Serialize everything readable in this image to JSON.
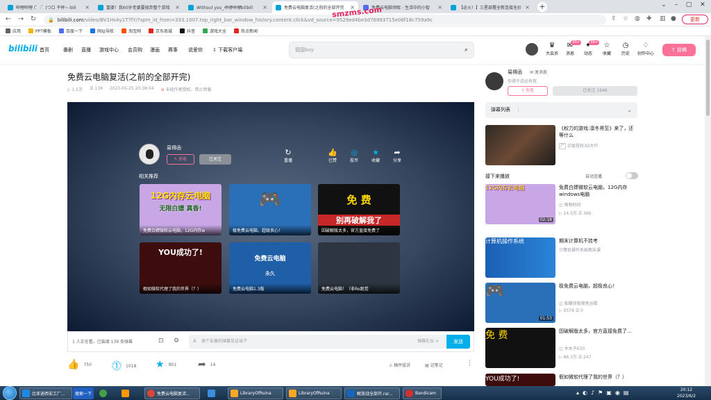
{
  "browser": {
    "tabs": [
      {
        "label": "哔哩哔哩 (゜-゜)つロ 干杯~-bili",
        "color": "#00a1d6"
      },
      {
        "label": "富婆！我60岁老婆要抛弃整个游戏",
        "color": "#00a1d6"
      },
      {
        "label": "Without you_哔哩哔哩bilibili",
        "color": "#00a1d6"
      },
      {
        "label": "免费云电脑复活(之前的全部开完",
        "color": "#00a1d6"
      },
      {
        "label": "免费云电脑领取 - 生活中的小智",
        "color": "#4e6ef2"
      },
      {
        "label": "【必火！】三星部署全新连接无价",
        "color": "#00a1d6"
      }
    ],
    "new_tab": "+",
    "url_host": "bilibili.com",
    "url_path": "/video/BV1Hs4y1T7fY/?spm_id_from=333.1007.top_right_bar_window_history.content.click&vd_source=9529ed4be3d76993715e06f18c759a9c",
    "watermark": "smzms.com",
    "update_label": "更新",
    "bookmarks": [
      {
        "label": "应用",
        "color": "#5f6368"
      },
      {
        "label": "PPT模板",
        "color": "#f4b400"
      },
      {
        "label": "百度一下",
        "color": "#4e6ef2"
      },
      {
        "label": "网址导航",
        "color": "#1a73e8"
      },
      {
        "label": "淘宝网",
        "color": "#ff5000"
      },
      {
        "label": "京东商城",
        "color": "#e1251b"
      },
      {
        "label": "抖音",
        "color": "#111111"
      },
      {
        "label": "游戏大全",
        "color": "#34a853"
      },
      {
        "label": "热点新闻",
        "color": "#e1251b"
      }
    ]
  },
  "bili_header": {
    "logo": "bilibili",
    "nav": [
      "首页",
      "番剧",
      "直播",
      "游戏中心",
      "会员购",
      "漫画",
      "赛事",
      "说爱你",
      "下载客户端"
    ],
    "search_placeholder": "德国boy",
    "user_icons": [
      {
        "label": "大会员",
        "icon": "crown-icon",
        "glyph": "♛",
        "badge": ""
      },
      {
        "label": "消息",
        "icon": "message-icon",
        "glyph": "✉",
        "badge": "99+"
      },
      {
        "label": "动态",
        "icon": "wind-icon",
        "glyph": "✦",
        "badge": "99+"
      },
      {
        "label": "收藏",
        "icon": "star-icon",
        "glyph": "☆",
        "badge": ""
      },
      {
        "label": "历史",
        "icon": "clock-icon",
        "glyph": "◷",
        "badge": ""
      },
      {
        "label": "创作中心",
        "icon": "bulb-icon",
        "glyph": "♢",
        "badge": ""
      }
    ],
    "upload_label": "↑ 投稿",
    "accent": "#fb7299"
  },
  "video": {
    "title": "免费云电脑复活(之前的全部开完)",
    "plays": "1.5万",
    "danmaku": "139",
    "date": "2023-05-25 20:38:04",
    "notice": "未经作者授权，禁止转载"
  },
  "player": {
    "up_name": "易得函",
    "charge": "充电",
    "followed": "已关注",
    "actions": [
      {
        "label": "重播",
        "glyph": "↻"
      },
      {
        "label": "已赞",
        "glyph": "👍"
      },
      {
        "label": "投币",
        "glyph": "◎"
      },
      {
        "label": "收藏",
        "glyph": "★"
      },
      {
        "label": "分享",
        "glyph": "➦"
      }
    ],
    "rec_title": "相关推荐",
    "recs": [
      {
        "caption": "免费白嫖微软云电脑，12G内存w",
        "big": "12G内存云电脑",
        "sub": "无限白嫖 真香!",
        "bg": "#c9a7e6",
        "fg": "#ffe600"
      },
      {
        "caption": "极免费云电脑，超级良心！",
        "big": "🎮",
        "sub": "",
        "bg": "#2a70b8",
        "fg": "#ffc300"
      },
      {
        "caption": "因破解版太多，官方直接免费了",
        "big": "免  费",
        "sub": "别再破解我了",
        "bg": "#111111",
        "fg": "#ffd700"
      },
      {
        "caption": "假如微软代理了我的世界（？）",
        "big": "YOU成功了!",
        "sub": "",
        "bg": "#3d0d0d",
        "fg": "#ffffff"
      },
      {
        "caption": "免费云电脑1.3版",
        "big": "免费云电脑",
        "sub": "永久",
        "bg": "#1e5fa8",
        "fg": "#ffffff"
      },
      {
        "caption": "免费云电脑！（非Ro跑觉",
        "big": "",
        "sub": "",
        "bg": "#2c3540",
        "fg": "#ffffff"
      }
    ]
  },
  "control_bar": {
    "viewers": "1 人正在看，已装填 139 条弹幕",
    "danmu_placeholder": "发个友善的弹幕见证当下",
    "etiquette": "弹幕礼仪 >",
    "send": "发送"
  },
  "actions": {
    "like": "750",
    "coin": "1018",
    "fav": "901",
    "share": "14",
    "report": "稿件投诉",
    "notes": "记笔记"
  },
  "sidebar": {
    "up_name": "易得函",
    "send_msg": "发消息",
    "up_desc": "你得干说必有我",
    "charge": "充电",
    "follow": "已关注 1948",
    "danmu_list": "弹幕列表",
    "ad": {
      "title": "《权力的游戏:凛冬将至》来了，还等什么",
      "sub": "正版授权3D大作"
    },
    "next_up": "接下来播放",
    "autoplay": "自动连播",
    "cards": [
      {
        "title": "免费白嫖微软云电脑，12G内存windows电脑",
        "uploader": "格物时间",
        "plays": "14.5万",
        "danmaku": "366",
        "duration": "02:18",
        "bg": "#c9a7e6",
        "big": "12G内存云电脑",
        "fg": "#ffe600"
      },
      {
        "title": "期末计算机不挂考",
        "uploader": "计算机操作系统期末课",
        "plays": "",
        "danmaku": "",
        "duration": "",
        "bg": "#1a5fb4",
        "big": "计算机操作系统",
        "fg": "#ffffff"
      },
      {
        "title": "极免费云电脑，超极良心！",
        "uploader": "痴蝶侠极限免谷歌",
        "plays": "9579",
        "danmaku": "0",
        "duration": "01:53",
        "bg": "#2a70b8",
        "big": "🎮",
        "fg": "#ffc300"
      },
      {
        "title": "因破解版太多，官方直接免费了...",
        "uploader": "木木子630",
        "plays": "86.3万",
        "danmaku": "247",
        "duration": "",
        "bg": "#111111",
        "big": "免  费",
        "fg": "#ffd700"
      },
      {
        "title": "假如微软代理了我的世界（？）",
        "uploader": "",
        "plays": "",
        "danmaku": "",
        "duration": "",
        "bg": "#3d0d0d",
        "big": "YOU成功了!",
        "fg": "#ffffff"
      }
    ]
  },
  "taskbar": {
    "items": [
      {
        "label": "比亚迪西安工厂...",
        "color": "#1e88e5"
      },
      {
        "label": "搜索一下",
        "color": "#2060c0"
      },
      {
        "label": "",
        "color": "#43a047"
      },
      {
        "label": "免费云电脑复活...",
        "color": "#db4437"
      },
      {
        "label": "",
        "color": "#3c8dde"
      },
      {
        "label": "LibraryOfRuina",
        "color": "#f9a825"
      },
      {
        "label": "LibraryOfRuina",
        "color": "#f9a825"
      },
      {
        "label": "解放战全部开.rar...",
        "color": "#1565c0"
      },
      {
        "label": "Bandicam",
        "color": "#d32f2f"
      }
    ],
    "time": "20:12",
    "date": "2023/6/2"
  }
}
